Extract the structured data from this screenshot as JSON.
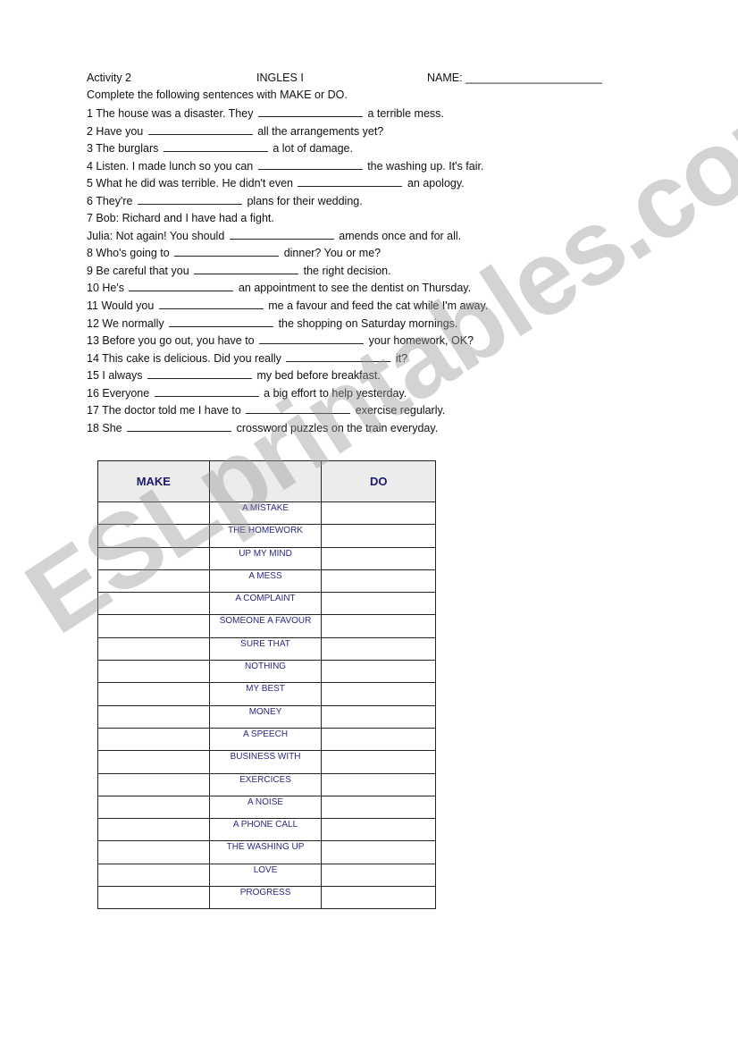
{
  "header": {
    "activity": "Activity 2",
    "course": "INGLES I",
    "name_label": "NAME: ______________________"
  },
  "instructions": "Complete the following sentences with MAKE or DO.",
  "sentences": [
    {
      "before": "1 The house was a disaster. They",
      "after": "a terrible mess."
    },
    {
      "before": "2 Have you",
      "after": "all the arrangements yet?"
    },
    {
      "before": "3 The burglars",
      "after": "a lot of damage."
    },
    {
      "before": "4 Listen. I made lunch so you can",
      "after": "the washing up. It's fair."
    },
    {
      "before": "5 What he did was terrible. He didn't even",
      "after": "an apology."
    },
    {
      "before": "6 They're",
      "after": "plans for their wedding."
    },
    {
      "before": "7 Bob: Richard and I have had a fight.",
      "after": ""
    },
    {
      "before": "Julia: Not again! You should",
      "after": "amends once and for all."
    },
    {
      "before": "8 Who's going to",
      "after": "dinner? You or me?"
    },
    {
      "before": "9 Be careful that you",
      "after": "the right decision."
    },
    {
      "before": "10 He's",
      "after": "an appointment to see the dentist on Thursday."
    },
    {
      "before": "11 Would you",
      "after": "me a favour and feed the cat while I'm away."
    },
    {
      "before": "12 We normally",
      "after": "the shopping on Saturday mornings."
    },
    {
      "before": "13 Before you go out, you have to",
      "after": "your homework, OK?"
    },
    {
      "before": "14 This cake is delicious. Did you really",
      "after": "it?"
    },
    {
      "before": "15 I always",
      "after": "my bed before breakfast."
    },
    {
      "before": "16 Everyone",
      "after": "a big effort to help yesterday."
    },
    {
      "before": "17 The doctor told me I have to",
      "after": "exercise regularly."
    },
    {
      "before": "18 She",
      "after": "crossword puzzles on the train everyday."
    }
  ],
  "table": {
    "headers": [
      "MAKE",
      "",
      "DO"
    ],
    "phrases": [
      "A MISTAKE",
      "THE HOMEWORK",
      "UP MY MIND",
      "A MESS",
      "A COMPLAINT",
      "SOMEONE A FAVOUR",
      "SURE THAT",
      "NOTHING",
      "MY BEST",
      "MONEY",
      "A SPEECH",
      "BUSINESS WITH",
      "EXERCICES",
      "A NOISE",
      "A PHONE CALL",
      "THE WASHING UP",
      "LOVE",
      "PROGRESS"
    ]
  },
  "watermark": "ESLprintables.com",
  "colors": {
    "table_text": "#2a2a80",
    "header_fill": "#ececec",
    "watermark": "#969696"
  }
}
